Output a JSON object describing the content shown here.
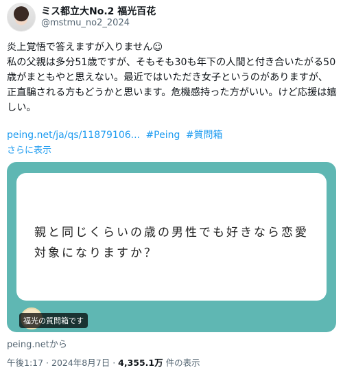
{
  "author": {
    "display_name": "ミス都立大No.2 福光百花",
    "handle": "@mstmu_no2_2024"
  },
  "tweet": {
    "text": "炎上覚悟で答えますが入りません☺\n私の父親は多分51歳ですが、そもそも30も年下の人間と付き合いたがる50歳がまともやと思えない。最近ではいただき女子というのがありますが、正直騙される方もどうかと思います。危機感持った方がいい。けど応援は嬉しい。",
    "link": "peing.net/ja/qs/11879106...",
    "hashtags": [
      "#Peing",
      "#質問箱"
    ],
    "show_more": "さらに表示"
  },
  "card": {
    "question": "親と同じくらいの歳の男性でも好きなら恋愛対象になりますか？",
    "badge": "福光の質問箱です",
    "accent_color": "#5fb7b3"
  },
  "source": "peing.netから",
  "meta": {
    "time": "午後1:17",
    "separator1": " · ",
    "date": "2024年8月7日",
    "separator2": " · ",
    "views": "4,355.1万",
    "views_label": " 件の表示"
  }
}
